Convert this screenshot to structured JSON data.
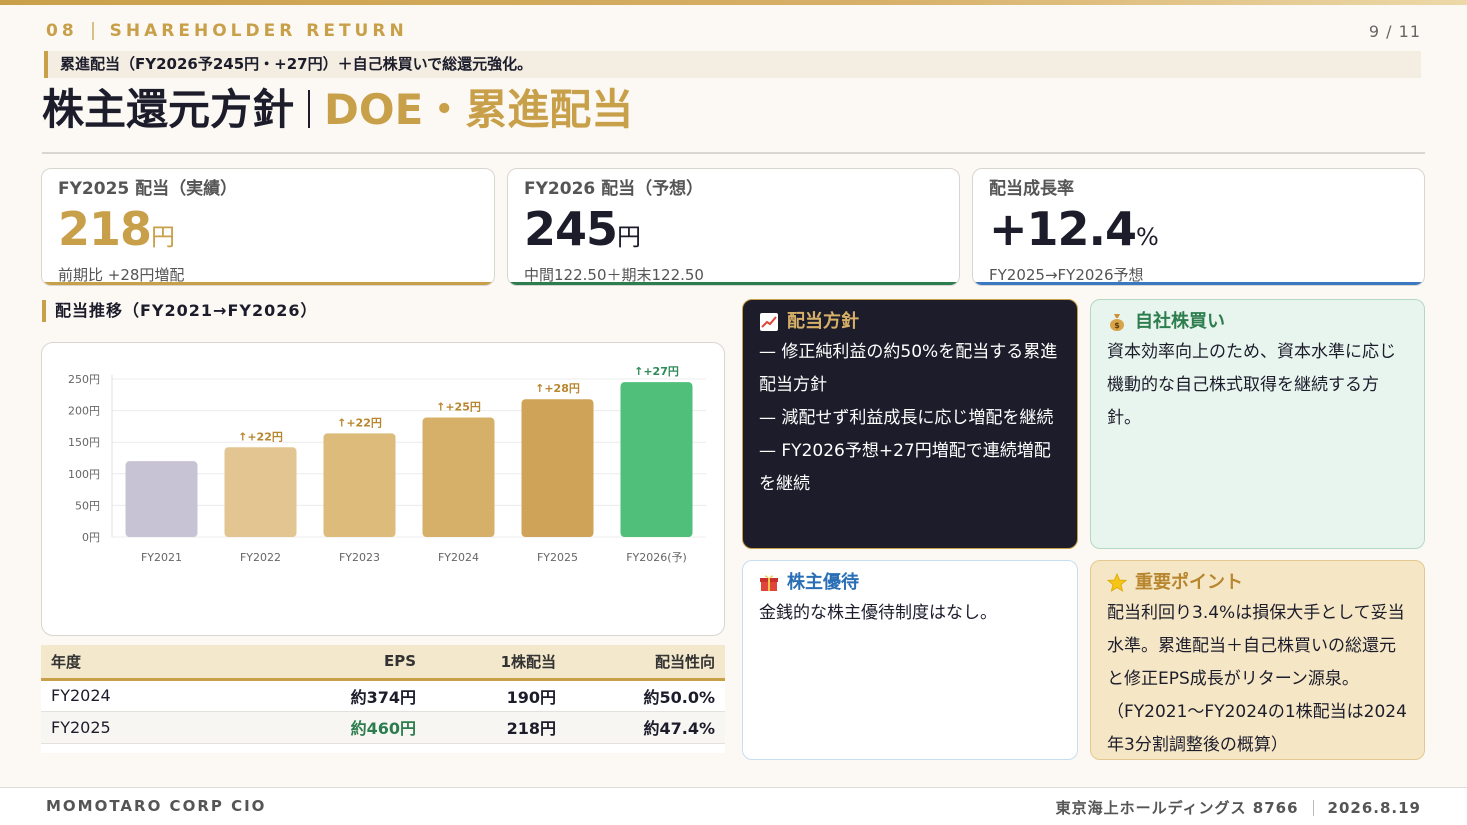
{
  "header": {
    "section_number": "08",
    "section_name": "SHAREHOLDER RETURN",
    "page_indicator": "9 / 11",
    "tagline": "累進配当（FY2026予245円・+27円）＋自己株買いで総還元強化。",
    "title_main": "株主還元方針",
    "title_accent": "DOE・累進配当"
  },
  "kpis": [
    {
      "label": "FY2025 配当（実績）",
      "value": "218",
      "unit": "円",
      "sub": "前期比 +28円増配",
      "color": "#c9a04a"
    },
    {
      "label": "FY2026 配当（予想）",
      "value": "245",
      "unit": "円",
      "sub": "中間122.50＋期末122.50",
      "color": "#1c1c2b",
      "line_color": "#2e7d4f"
    },
    {
      "label": "配当成長率",
      "value": "+12.4",
      "unit": "%",
      "sub": "FY2025→FY2026予想",
      "color": "#1c1c2b",
      "line_color": "#3a78c2"
    }
  ],
  "chart_section_title": "配当推移（FY2021→FY2026）",
  "chart_data": {
    "type": "bar",
    "categories": [
      "FY2021",
      "FY2022",
      "FY2023",
      "FY2024",
      "FY2025",
      "FY2026(予)"
    ],
    "values": [
      120,
      142,
      164,
      189,
      218,
      245
    ],
    "annotations": [
      "",
      "↑+22円",
      "↑+22円",
      "↑+25円",
      "↑+28円",
      "↑+27円"
    ],
    "yticks": [
      "0円",
      "50円",
      "100円",
      "150円",
      "200円",
      "250円"
    ],
    "ylim": [
      0,
      250
    ],
    "colors": [
      "#c7c3d4",
      "#e2c590",
      "#ddbb7a",
      "#d6b068",
      "#cfa358",
      "#4fbf7a"
    ],
    "annotation_colors": [
      "",
      "#b8862e",
      "#b8862e",
      "#b8862e",
      "#b8862e",
      "#2e8b57"
    ],
    "grid": true
  },
  "table": {
    "headers": [
      "年度",
      "EPS",
      "1株配当",
      "配当性向"
    ],
    "rows": [
      [
        "FY2024",
        "約374円",
        "190円",
        "約50.0%"
      ],
      [
        "FY2025",
        "約460円",
        "218円",
        "約47.4%"
      ]
    ]
  },
  "cards": {
    "policy": {
      "icon": "chart-up-icon",
      "title": "配当方針",
      "lines": [
        "— 修正純利益の約50%を配当する累進配当方針",
        "— 減配せず利益成長に応じ増配を継続",
        "— FY2026予想+27円増配で連続増配を継続"
      ]
    },
    "buyback": {
      "icon": "money-bag-icon",
      "title": "自社株買い",
      "body": "資本効率向上のため、資本水準に応じ機動的な自己株式取得を継続する方針。"
    },
    "benefits": {
      "icon": "gift-icon",
      "title": "株主優待",
      "body": "金銭的な株主優待制度はなし。"
    },
    "key_point": {
      "icon": "star-icon",
      "title": "重要ポイント",
      "body": "配当利回り3.4%は損保大手として妥当水準。累進配当＋自己株買いの総還元と修正EPS成長がリターン源泉。（FY2021〜FY2024の1株配当は2024年3分割調整後の概算）"
    }
  },
  "footer": {
    "left": "MOMOTARO CORP CIO",
    "company": "東京海上ホールディングス 8766",
    "date": "2026.8.19"
  }
}
